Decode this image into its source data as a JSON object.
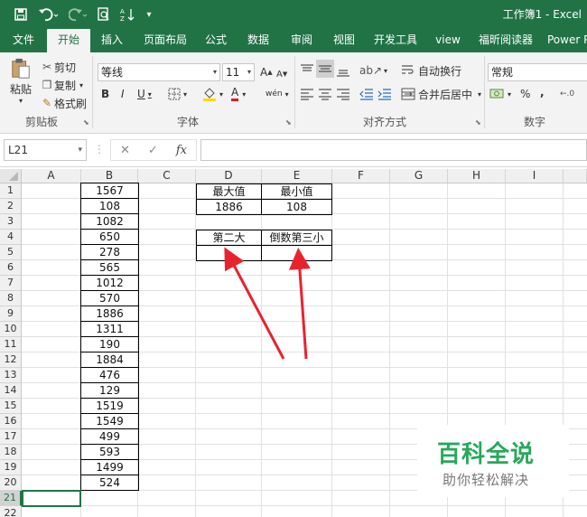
{
  "titlebar": {
    "title": "工作簿1 - Excel",
    "icons": [
      "save-icon",
      "undo-icon",
      "redo-icon",
      "print-preview-icon",
      "sort-icon",
      "customize-icon"
    ]
  },
  "tabs": [
    "文件",
    "开始",
    "插入",
    "页面布局",
    "公式",
    "数据",
    "审阅",
    "视图",
    "开发工具",
    "view",
    "福昕阅读器",
    "Power P"
  ],
  "active_tab": "开始",
  "ribbon": {
    "clipboard": {
      "paste": "粘贴",
      "cut": "剪切",
      "copy": "复制",
      "format_painter": "格式刷",
      "label": "剪贴板"
    },
    "font": {
      "name": "等线",
      "size": "11",
      "bold": "B",
      "italic": "I",
      "underline": "U",
      "grow": "A",
      "shrink": "A",
      "font_color": "A",
      "phonetic": "wén",
      "label": "字体"
    },
    "alignment": {
      "wrap": "自动换行",
      "merge": "合并后居中",
      "label": "对齐方式"
    },
    "number": {
      "format": "常规",
      "percent": "%",
      "comma": ",",
      "label": "数字"
    }
  },
  "formula_bar": {
    "name_box": "L21",
    "cancel": "✕",
    "enter": "✓",
    "fx": "fx",
    "value": ""
  },
  "columns": [
    "A",
    "B",
    "C",
    "D",
    "E",
    "F",
    "G",
    "H",
    "I"
  ],
  "rows": [
    "1",
    "2",
    "3",
    "4",
    "5",
    "6",
    "7",
    "8",
    "9",
    "10",
    "11",
    "12",
    "13",
    "14",
    "15",
    "16",
    "17",
    "18",
    "19",
    "20",
    "21",
    "22"
  ],
  "selected_row": "21",
  "column_b_values": [
    "1567",
    "108",
    "1082",
    "650",
    "278",
    "565",
    "1012",
    "570",
    "1886",
    "1311",
    "190",
    "1884",
    "476",
    "129",
    "1519",
    "1549",
    "499",
    "593",
    "1499",
    "524"
  ],
  "summary": {
    "max_label": "最大值",
    "min_label": "最小值",
    "max_value": "1886",
    "min_value": "108",
    "second_largest_label": "第二大",
    "third_smallest_label": "倒数第三小",
    "second_largest_value": "",
    "third_smallest_value": ""
  },
  "annotation": {
    "arrow_color": "#e8232e"
  },
  "watermark": {
    "main": "百科全说",
    "sub": "助你轻松解决",
    "color": "#27a85a"
  }
}
